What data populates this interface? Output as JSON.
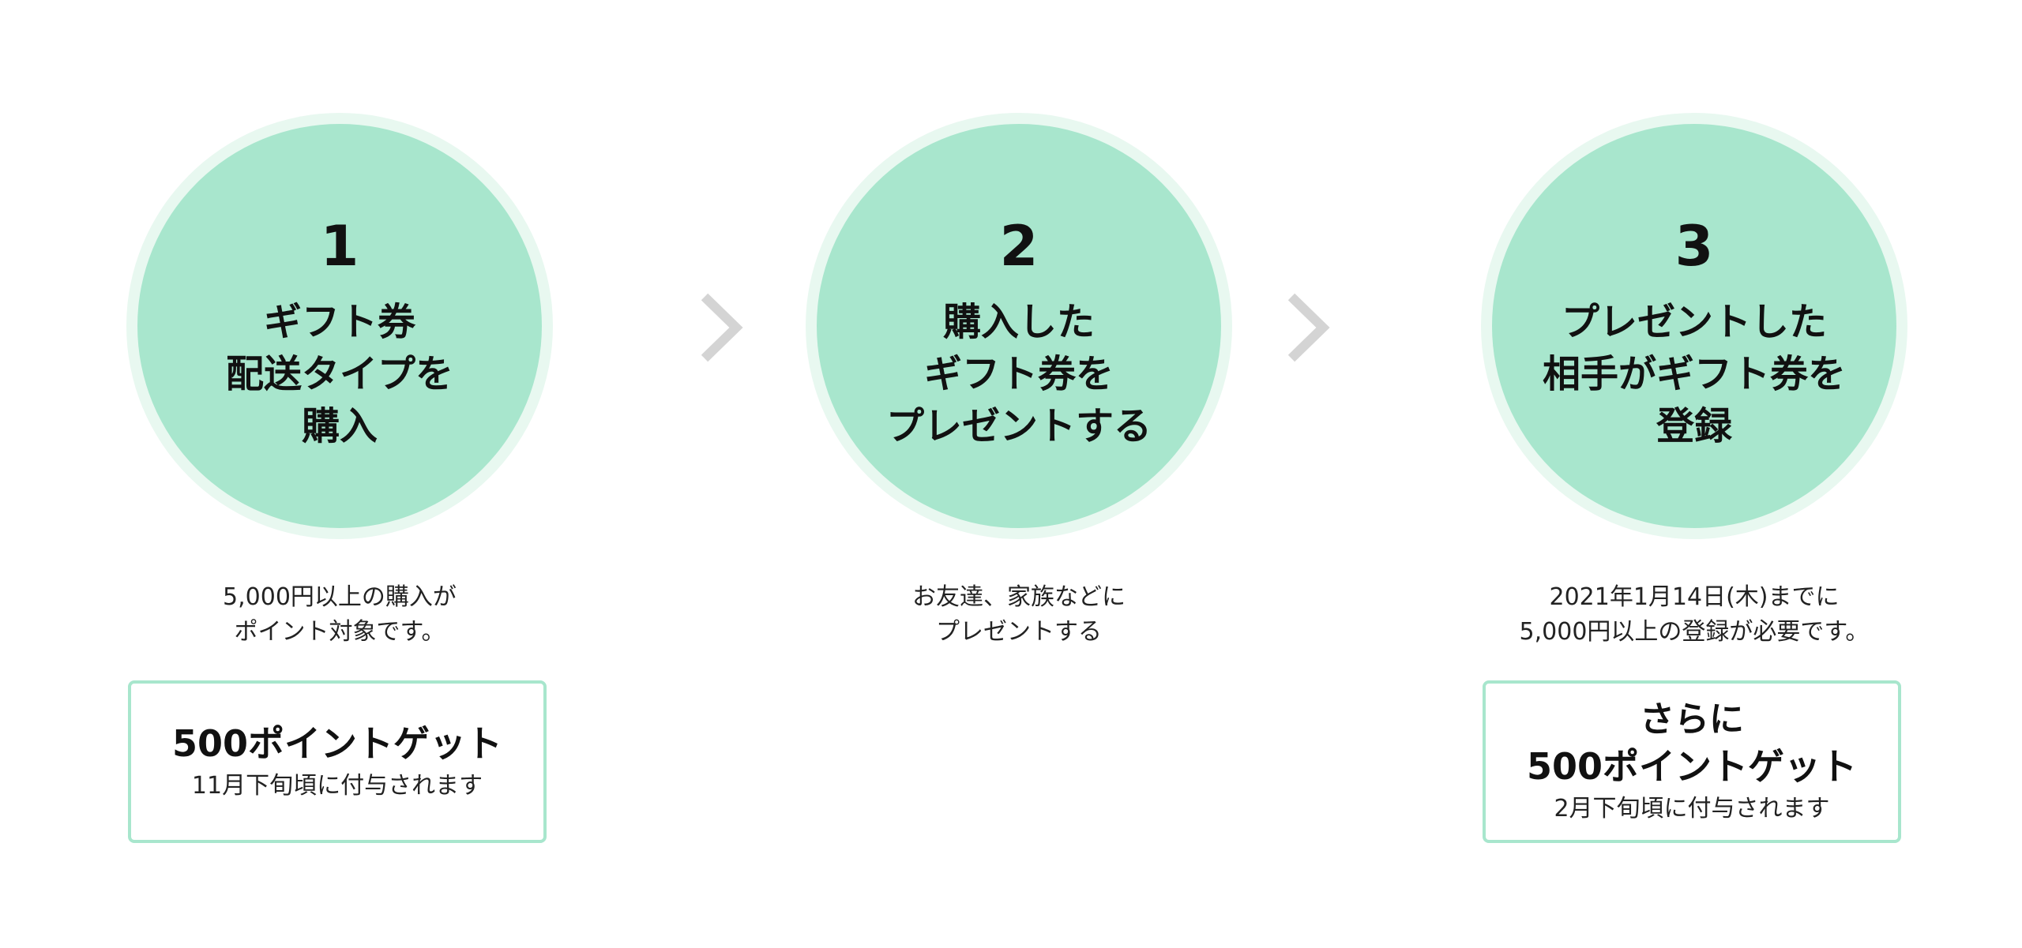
{
  "steps": [
    {
      "number": "1",
      "title_lines": [
        "ギフト券",
        "配送タイプを",
        "購入"
      ],
      "desc_lines": [
        "5,000円以上の購入が",
        "ポイント対象です。"
      ],
      "box": {
        "pre": "",
        "main": "500ポイントゲット",
        "sub": "11月下旬頃に付与されます"
      }
    },
    {
      "number": "2",
      "title_lines": [
        "購入した",
        "ギフト券を",
        "プレゼントする"
      ],
      "desc_lines": [
        "お友達、家族などに",
        "プレゼントする"
      ]
    },
    {
      "number": "3",
      "title_lines": [
        "プレゼントした",
        "相手がギフト券を",
        "登録"
      ],
      "desc_lines": [
        "2021年1月14日(木)までに",
        "5,000円以上の登録が必要です。"
      ],
      "box": {
        "pre": "さらに",
        "main": "500ポイントゲット",
        "sub": "2月下旬頃に付与されます"
      }
    }
  ],
  "icons": {
    "arrow": "chevron-right-icon"
  },
  "colors": {
    "circle_fill": "#a8e6cd",
    "circle_ring": "#e8f8f0",
    "box_border": "#a8e6cd",
    "chevron": "#d4d4d4"
  }
}
